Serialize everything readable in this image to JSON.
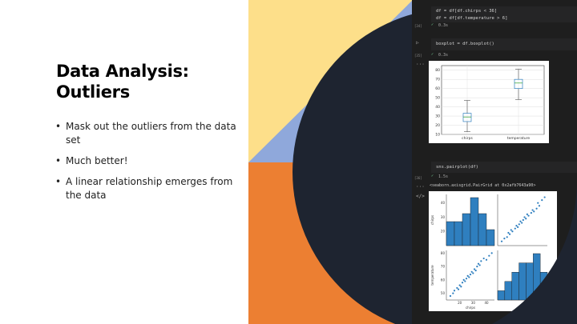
{
  "slide": {
    "title_line1": "Data Analysis:",
    "title_line2": "Outliers",
    "bullets": [
      "Mask out the outliers from the data set",
      "Much better!",
      "A linear relationship emerges from the data"
    ],
    "bullet_char": "•"
  },
  "colors": {
    "yellow": "#fddf8a",
    "blue": "#8fa8db",
    "orange": "#ec7f32",
    "dark_navy": "#1e2430",
    "plot_blue": "#2f7fbf",
    "check_green": "#73c991"
  },
  "notebook": {
    "cell1": {
      "lines": [
        "df = df[df.chirps < 36]",
        "df = df[df.temperature > 6]"
      ],
      "exec_count": "[34]",
      "status": "0.3s"
    },
    "cell2": {
      "code": "boxplot = df.boxplot()",
      "exec_count": "[35]",
      "status": "0.3s"
    },
    "cell3": {
      "code": "sns.pairplot(df)",
      "exec_count": "[36]",
      "status": "1.5s",
      "output": "<seaborn.axisgrid.PairGrid at 0x2afb7643a90>"
    },
    "icons": {
      "run": "play-icon",
      "more": "ellipsis-icon",
      "output": "output-icon",
      "check": "check-icon"
    }
  },
  "chart_data": [
    {
      "type": "box",
      "categories": [
        "chirps",
        "temperature"
      ],
      "series": [
        {
          "name": "chirps",
          "min": 13,
          "q1": 24,
          "median": 29,
          "q3": 33,
          "max": 47
        },
        {
          "name": "temperature",
          "min": 48,
          "q1": 60,
          "median": 66,
          "q3": 70,
          "max": 81
        }
      ],
      "y_ticks": [
        10,
        20,
        30,
        40,
        50,
        60,
        70,
        80
      ],
      "ylim": [
        10,
        85
      ],
      "grid": true
    },
    {
      "type": "scatter",
      "description_panel": "pairplot",
      "x_label": "chirps",
      "y_labels": [
        "chirps",
        "temperature"
      ],
      "hist_chirps": [
        3,
        3,
        4,
        6,
        4,
        2
      ],
      "hist_temperature": [
        1,
        2,
        3,
        4,
        4,
        5,
        3
      ],
      "scatter_points": [
        [
          13,
          48
        ],
        [
          15,
          50
        ],
        [
          16,
          52
        ],
        [
          18,
          54
        ],
        [
          19,
          53
        ],
        [
          20,
          56
        ],
        [
          21,
          55
        ],
        [
          22,
          58
        ],
        [
          23,
          60
        ],
        [
          24,
          59
        ],
        [
          25,
          61
        ],
        [
          26,
          63
        ],
        [
          27,
          62
        ],
        [
          28,
          64
        ],
        [
          29,
          66
        ],
        [
          30,
          65
        ],
        [
          31,
          68
        ],
        [
          32,
          67
        ],
        [
          33,
          70
        ],
        [
          34,
          72
        ],
        [
          35,
          71
        ],
        [
          36,
          74
        ],
        [
          38,
          76
        ],
        [
          40,
          75
        ],
        [
          42,
          78
        ],
        [
          44,
          80
        ]
      ],
      "x_ticks": [
        20,
        30,
        40
      ],
      "y_ticks_chirps": [
        20,
        30,
        40
      ],
      "y_ticks_temperature": [
        50,
        60,
        70,
        80
      ]
    }
  ]
}
